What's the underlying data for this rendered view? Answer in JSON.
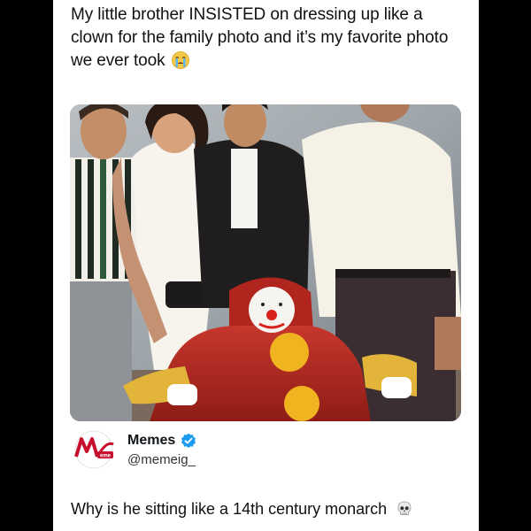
{
  "post": {
    "caption": "My little brother INSISTED on dressing up like a clown for the family photo and it’s my favorite photo we ever took",
    "caption_emoji": "loudly-crying-face-emoji",
    "image_description_icon": "family-photo-with-clown",
    "colors": {
      "background": "#000000",
      "card": "#ffffff",
      "verified": "#1d9bf0",
      "clown_suit": "#c1271f",
      "pompom": "#f0b420"
    }
  },
  "quoted_author": {
    "name": "Memes",
    "handle": "@memeig_",
    "avatar_icon": "memes-logo",
    "verified_icon": "verified-badge-icon"
  },
  "reply": {
    "text": "Why is he sitting like a 14th century monarch",
    "emoji": "skull-emoji"
  }
}
